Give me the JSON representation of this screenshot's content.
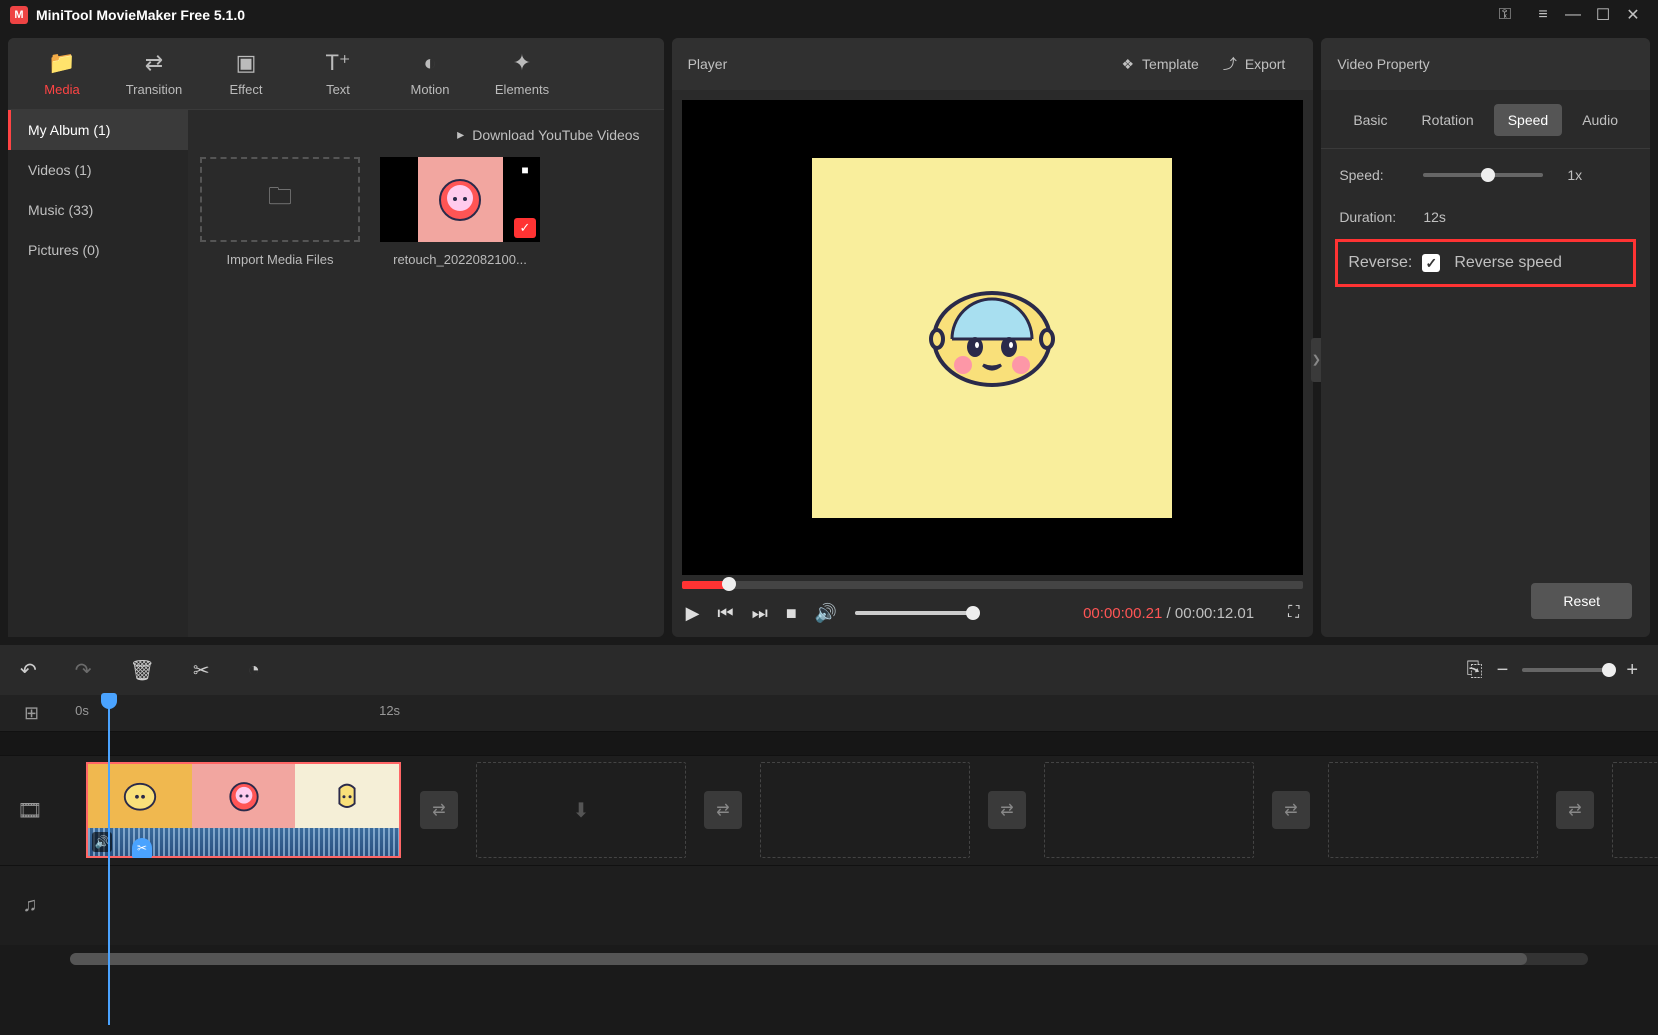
{
  "titlebar": {
    "title": "MiniTool MovieMaker Free 5.1.0"
  },
  "tabs": {
    "media": "Media",
    "transition": "Transition",
    "effect": "Effect",
    "text": "Text",
    "motion": "Motion",
    "elements": "Elements"
  },
  "sidebar": {
    "my_album": "My Album (1)",
    "videos": "Videos (1)",
    "music": "Music (33)",
    "pictures": "Pictures (0)"
  },
  "media": {
    "download_yt": "Download YouTube Videos",
    "import_label": "Import Media Files",
    "clip1_label": "retouch_2022082100..."
  },
  "player": {
    "title": "Player",
    "template": "Template",
    "export": "Export",
    "time_current": "00:00:00.21",
    "time_sep": " / ",
    "time_total": "00:00:12.01"
  },
  "property": {
    "title": "Video Property",
    "tabs": {
      "basic": "Basic",
      "rotation": "Rotation",
      "speed": "Speed",
      "audio": "Audio"
    },
    "speed_label": "Speed:",
    "speed_value": "1x",
    "duration_label": "Duration:",
    "duration_value": "12s",
    "reverse_label": "Reverse:",
    "reverse_check_label": "Reverse speed",
    "reset": "Reset"
  },
  "timeline": {
    "ruler_0s": "0s",
    "ruler_12s": "12s"
  }
}
